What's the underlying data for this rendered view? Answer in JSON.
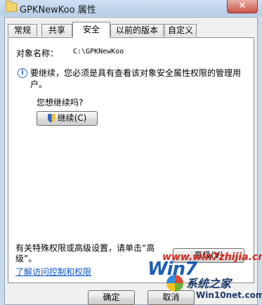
{
  "window": {
    "title": "GPKNewKoo 属性",
    "close_label": "✕"
  },
  "tabs": [
    {
      "label": "常规",
      "active": false
    },
    {
      "label": "共享",
      "active": false
    },
    {
      "label": "安全",
      "active": true
    },
    {
      "label": "以前的版本",
      "active": false
    },
    {
      "label": "自定义",
      "active": false
    }
  ],
  "security": {
    "object_name_label": "对象名称：",
    "object_path": "C:\\GPKNewKoo",
    "info_message": "要继续，您必须是具有查看该对象安全属性权限的管理用户。",
    "question": "您想继续吗?",
    "continue_button": "继续(C)",
    "advanced_text": "有关特殊权限或高级设置，请单击“高级”。",
    "advanced_button": "高级(V)",
    "help_link": "了解访问控制和权限"
  },
  "footer": {
    "ok_button": "确定",
    "cancel_button": "取消"
  },
  "watermark": {
    "logo": "Win7",
    "url": "www.win7zhijia.cn",
    "site_cn": "系统之家",
    "site_en": "Win10net.com"
  },
  "icons": {
    "folder": "folder-icon",
    "info": "info-icon",
    "shield": "uac-shield-icon"
  }
}
